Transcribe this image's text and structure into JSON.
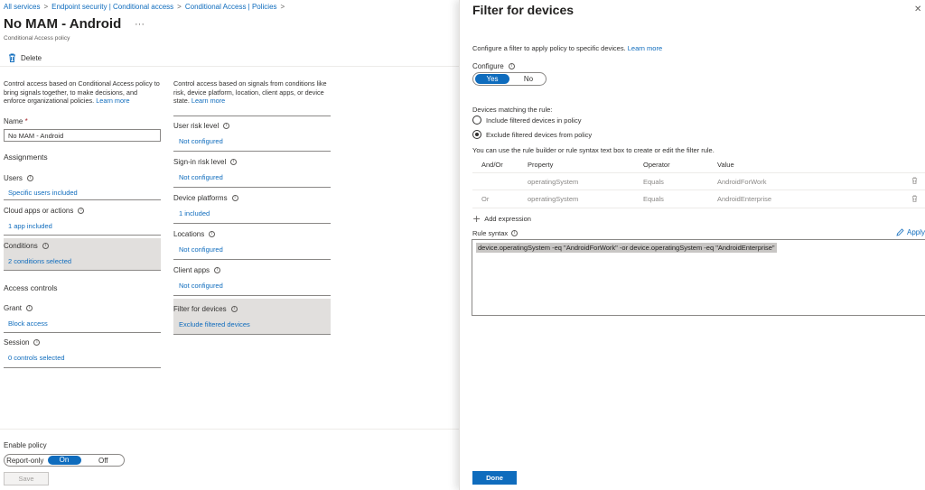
{
  "breadcrumb": [
    "All services",
    "Endpoint security | Conditional access",
    "Conditional Access | Policies"
  ],
  "page": {
    "title": "No MAM - Android",
    "more": "···",
    "subtitle": "Conditional Access policy",
    "delete_label": "Delete"
  },
  "left": {
    "description": "Control access based on Conditional Access policy to bring signals together, to make decisions, and enforce organizational policies.",
    "learn_more": "Learn more",
    "name_label": "Name",
    "name_required": "*",
    "name_value": "No MAM - Android",
    "assignments_heading": "Assignments",
    "users_label": "Users",
    "users_value": "Specific users included",
    "cloud_label": "Cloud apps or actions",
    "cloud_value": "1 app included",
    "conditions_label": "Conditions",
    "conditions_value": "2 conditions selected",
    "access_heading": "Access controls",
    "grant_label": "Grant",
    "grant_value": "Block access",
    "session_label": "Session",
    "session_value": "0 controls selected"
  },
  "right": {
    "description": "Control access based on signals from conditions like risk, device platform, location, client apps, or device state.",
    "learn_more": "Learn more",
    "items": [
      {
        "label": "User risk level",
        "value": "Not configured"
      },
      {
        "label": "Sign-in risk level",
        "value": "Not configured"
      },
      {
        "label": "Device platforms",
        "value": "1 included"
      },
      {
        "label": "Locations",
        "value": "Not configured"
      },
      {
        "label": "Client apps",
        "value": "Not configured"
      },
      {
        "label": "Filter for devices",
        "value": "Exclude filtered devices"
      }
    ]
  },
  "footer": {
    "enable_label": "Enable policy",
    "options": [
      "Report-only",
      "On",
      "Off"
    ],
    "selected": "On",
    "save_label": "Save"
  },
  "panel": {
    "title": "Filter for devices",
    "close": "✕",
    "description": "Configure a filter to apply policy to specific devices.",
    "learn_more": "Learn more",
    "configure_label": "Configure",
    "configure_options": [
      "Yes",
      "No"
    ],
    "configure_selected": "Yes",
    "matching_label": "Devices matching the rule:",
    "include_option": "Include filtered devices in policy",
    "exclude_option": "Exclude filtered devices from policy",
    "use_hint": "You can use the rule builder or rule syntax text box to create or edit the filter rule.",
    "table_headers": [
      "And/Or",
      "Property",
      "Operator",
      "Value"
    ],
    "rows": [
      {
        "andor": "",
        "property": "operatingSystem",
        "operator": "Equals",
        "value": "AndroidForWork"
      },
      {
        "andor": "Or",
        "property": "operatingSystem",
        "operator": "Equals",
        "value": "AndroidEnterprise"
      }
    ],
    "add_expression": "Add expression",
    "rule_syntax_label": "Rule syntax",
    "apply_label": "Apply",
    "rule_syntax": "device.operatingSystem -eq \"AndroidForWork\" -or device.operatingSystem -eq \"AndroidEnterprise\"",
    "done_label": "Done"
  },
  "colors": {
    "accent": "#0f6cbd",
    "highlight": "#e1dfdd",
    "required": "#a4262c"
  },
  "icons": [
    "trash-icon",
    "info-icon",
    "plus-icon",
    "pencil-icon",
    "close-icon"
  ]
}
